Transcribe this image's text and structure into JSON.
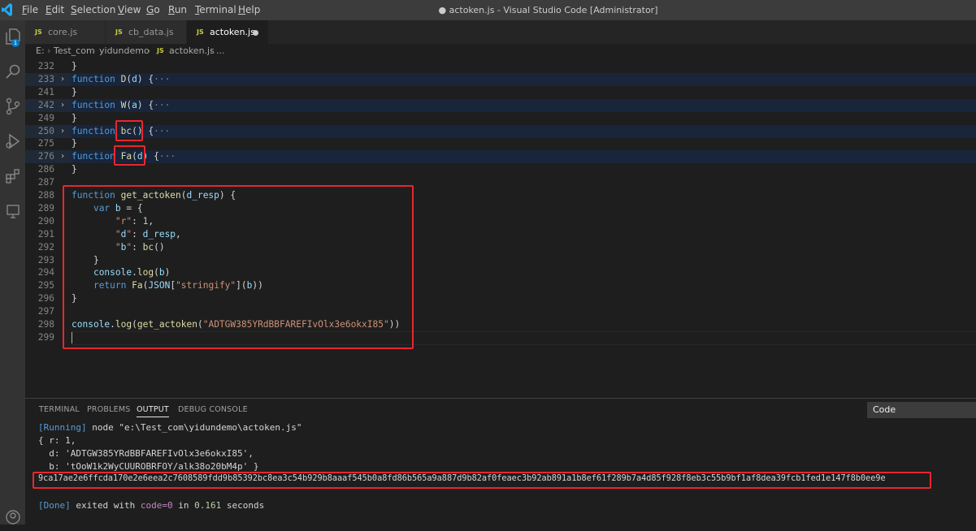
{
  "menu": [
    "File",
    "Edit",
    "Selection",
    "View",
    "Go",
    "Run",
    "Terminal",
    "Help"
  ],
  "window_title": "● actoken.js - Visual Studio Code [Administrator]",
  "activity": {
    "explorer_badge": "1"
  },
  "tabs": [
    {
      "icon": "JS",
      "label": "core.js"
    },
    {
      "icon": "JS",
      "label": "cb_data.js"
    },
    {
      "icon": "JS",
      "label": "actoken.js"
    }
  ],
  "breadcrumb": [
    "E:",
    "Test_com",
    "yidundemo",
    "actoken.js",
    "..."
  ],
  "editor": {
    "lines": [
      {
        "n": "232",
        "text": "}"
      },
      {
        "n": "233",
        "text": "function D(d) {···"
      },
      {
        "n": "241",
        "text": "}"
      },
      {
        "n": "242",
        "text": "function W(a) {···"
      },
      {
        "n": "249",
        "text": "}"
      },
      {
        "n": "250",
        "text": "function bc() {···"
      },
      {
        "n": "275",
        "text": "}"
      },
      {
        "n": "276",
        "text": "function Fa(d) {···"
      },
      {
        "n": "286",
        "text": "}"
      },
      {
        "n": "287",
        "text": ""
      },
      {
        "n": "288",
        "text": "function get_actoken(d_resp) {"
      },
      {
        "n": "289",
        "text": "    var b = {"
      },
      {
        "n": "290",
        "text": "        \"r\": 1,"
      },
      {
        "n": "291",
        "text": "        \"d\": d_resp,"
      },
      {
        "n": "292",
        "text": "        \"b\": bc()"
      },
      {
        "n": "293",
        "text": "    }"
      },
      {
        "n": "294",
        "text": "    console.log(b)"
      },
      {
        "n": "295",
        "text": "    return Fa(JSON[\"stringify\"](b))"
      },
      {
        "n": "296",
        "text": "}"
      },
      {
        "n": "297",
        "text": ""
      },
      {
        "n": "298",
        "text": "console.log(get_actoken(\"ADTGW385YRdBBFAREFIvOlx3e6okxI85\"))"
      },
      {
        "n": "299",
        "text": ""
      }
    ]
  },
  "panel": {
    "tabs": [
      "TERMINAL",
      "PROBLEMS",
      "OUTPUT",
      "DEBUG CONSOLE"
    ],
    "active_tab": "OUTPUT",
    "channel": "Code",
    "output": [
      "[Running] node \"e:\\Test_com\\yidundemo\\actoken.js\"",
      "{ r: 1,",
      "  d: 'ADTGW385YRdBBFAREFIvOlx3e6okxI85',",
      "  b: 'tOoW1k2WyCUUROBRFOY/alk38o20bM4p' }",
      "9ca17ae2e6ffcda170e2e6eea2c7608589fdd9b85392bc8ea3c54b929b8aaaf545b0a8fd86b565a9a887d9b82af0feaec3b92ab891a1b8ef61f289b7a4d85f928f8eb3c55b9bf1af8dea39fcb1fed1e147f8b0ee9e",
      "",
      "[Done] exited with code=0 in 0.161 seconds"
    ]
  }
}
